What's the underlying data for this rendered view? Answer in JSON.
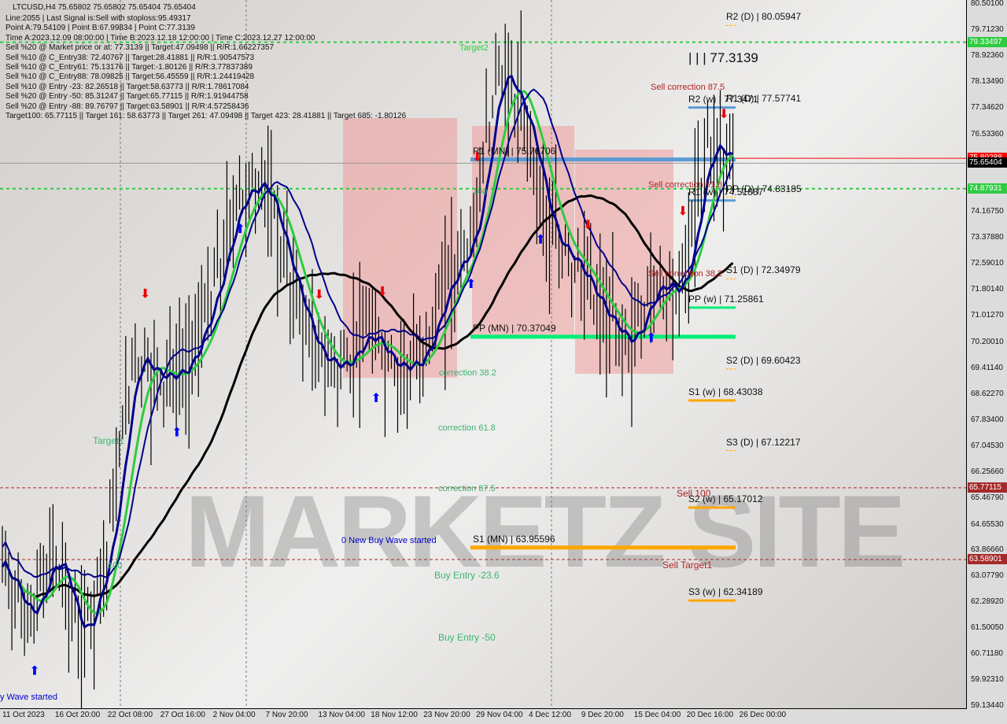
{
  "header": {
    "symbol_line": "LTCUSD,H4  75.65802 75.65802 75.65404 75.65404",
    "lines": [
      "Line:2055 | Last Signal is:Sell with stoploss:95.49317",
      "Point A:79.54109 | Point B:67.99834 | Point C:77.3139",
      "Time A:2023.12.09 08:00:00 | Time B:2023.12.18 12:00:00 | Time C:2023.12.27 12:00:00",
      "Sell %20 @ Market price or at: 77.3139 || Target:47.09498 || R/R:1.66227357",
      "Sell %10 @ C_Entry38: 72.40767 || Target:28.41881 || R/R:1.90547573",
      "Sell %10 @ C_Entry61: 75.13176 || Target:-1.80126 || R/R:3.77837389",
      "Sell %10 @ C_Entry88: 78.09825 || Target:56.45559 || R/R:1.24419428",
      "Sell %10 @ Entry -23: 82.26518 || Target:58.63773 || R/R:1.78617084",
      "Sell %20 @ Entry -50: 85.31247 || Target:65.77115 || R/R:1.91944758",
      "Sell %20 @ Entry -88: 89.76797 || Target:63.58901 || R/R:4.57258436",
      "Target100: 65.77115 || Target 161: 58.63773 || Target 261: 47.09498 || Target 423: 28.41881 || Target 685: -1.80126"
    ]
  },
  "watermark": "MARKETZ SITE",
  "chart_data": {
    "type": "candlestick",
    "ylim": [
      59.1344,
      80.501
    ],
    "y_ticks": [
      "80.50100",
      "79.71230",
      "78.92360",
      "78.13490",
      "77.34620",
      "76.53360",
      "75.80288",
      "75.65404",
      "74.16750",
      "73.37880",
      "72.59010",
      "71.80140",
      "71.01270",
      "70.20010",
      "69.41140",
      "68.62270",
      "67.83400",
      "67.04530",
      "66.25660",
      "65.46790",
      "64.65530",
      "63.86660",
      "63.07790",
      "62.28920",
      "61.50050",
      "60.71180",
      "59.92310",
      "59.13440"
    ],
    "x_ticks": [
      "11 Oct 2023",
      "16 Oct 20:00",
      "22 Oct 08:00",
      "27 Oct 16:00",
      "2 Nov 04:00",
      "7 Nov 20:00",
      "13 Nov 04:00",
      "18 Nov 12:00",
      "23 Nov 20:00",
      "29 Nov 04:00",
      "4 Dec 12:00",
      "9 Dec 20:00",
      "15 Dec 04:00",
      "20 Dec 16:00",
      "26 Dec 00:00"
    ],
    "price_path": [
      [
        0,
        63.37
      ],
      [
        1,
        61.7
      ],
      [
        2,
        63.9
      ],
      [
        3,
        61.0
      ],
      [
        4,
        63.85
      ],
      [
        5,
        69.84
      ],
      [
        6,
        69.1
      ],
      [
        7,
        69.36
      ],
      [
        8,
        71.5
      ],
      [
        9,
        74.6
      ],
      [
        10,
        75.1
      ],
      [
        11,
        72.2
      ],
      [
        12,
        69.8
      ],
      [
        13,
        69.4
      ],
      [
        14,
        70.56
      ],
      [
        15,
        69.4
      ],
      [
        16,
        69.6
      ],
      [
        17,
        72.0
      ],
      [
        18,
        73.4
      ],
      [
        19,
        78.7
      ],
      [
        20,
        77.0
      ],
      [
        21,
        73.4
      ],
      [
        22,
        72.5
      ],
      [
        23,
        71.04
      ],
      [
        24,
        70.08
      ],
      [
        25,
        72.0
      ],
      [
        26,
        71.76
      ],
      [
        27,
        76.3
      ],
      [
        28,
        75.65
      ]
    ],
    "tags": [
      {
        "value": "79.33497",
        "color": "#2ecc40"
      },
      {
        "value": "75.80288",
        "color": "#ff0000"
      },
      {
        "value": "75.65404",
        "color": "#000000"
      },
      {
        "value": "74.87931",
        "color": "#2ecc40"
      },
      {
        "value": "65.77115",
        "color": "#a52a2a"
      },
      {
        "value": "63.58901",
        "color": "#a52a2a"
      }
    ],
    "pivot_levels": [
      {
        "label": "R2 (D) | 80.05947",
        "value": 80.05947,
        "kind": "D"
      },
      {
        "label": "R1 (D) | 77.57741",
        "value": 77.57741,
        "kind": "D"
      },
      {
        "label": "PP (D) | 74.83185",
        "value": 74.83185,
        "kind": "D"
      },
      {
        "label": "S1 (D) | 72.34979",
        "value": 72.34979,
        "kind": "D"
      },
      {
        "label": "S2 (D) | 69.60423",
        "value": 69.60423,
        "kind": "D"
      },
      {
        "label": "S3 (D) | 67.12217",
        "value": 67.12217,
        "kind": "D"
      },
      {
        "label": "R2 (w) | 77.3471",
        "value": 77.3471,
        "kind": "w",
        "color": "#5b9bd5"
      },
      {
        "label": "R1 (w) | 74.51887",
        "value": 74.51887,
        "kind": "w",
        "color": "#5b9bd5"
      },
      {
        "label": "PP (w) | 71.25861",
        "value": 71.25861,
        "kind": "w",
        "color": "#00ee76"
      },
      {
        "label": "S1 (w) | 68.43038",
        "value": 68.43038,
        "kind": "w",
        "color": "#ffa500"
      },
      {
        "label": "S2 (w) | 65.17012",
        "value": 65.17012,
        "kind": "w",
        "color": "#ffa500"
      },
      {
        "label": "S3 (w) | 62.34189",
        "value": 62.34189,
        "kind": "w",
        "color": "#ffa500"
      },
      {
        "label": "R1 (MN) | 75.76706",
        "value": 75.76706,
        "kind": "MN",
        "color": "#5b9bd5"
      },
      {
        "label": "PP (MN) | 70.37049",
        "value": 70.37049,
        "kind": "MN",
        "color": "#00ee76"
      },
      {
        "label": "S1 (MN) | 63.95596",
        "value": 63.95596,
        "kind": "MN",
        "color": "#ffa500"
      }
    ],
    "point_c_label": "| | | 77.3139",
    "annotations": {
      "target2": "Target2",
      "hundred": "100",
      "corr38": "correction 38.2",
      "corr61": "correction 61.8",
      "corr87": "correction 87.5",
      "new_buy": "0 New Buy Wave started",
      "buy23": "Buy Entry -23.6",
      "buy50": "Buy Entry -50",
      "target1": "Target1",
      "wave_started": "y Wave started",
      "left100": "100",
      "sell87": "Sell correction 87.5",
      "sell61": "Sell correction 61.8",
      "sell38": "Sell correction 38.2",
      "sell100": "Sell 100",
      "sell_target1": "Sell Target1"
    }
  }
}
